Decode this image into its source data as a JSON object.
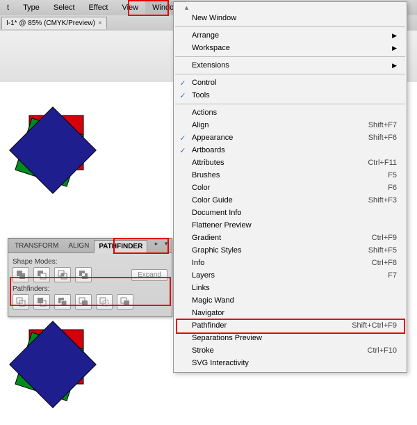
{
  "menubar": {
    "items": [
      "t",
      "Type",
      "Select",
      "Effect",
      "View",
      "Window"
    ],
    "highlighted_index": 5
  },
  "doc_tab": {
    "label": "I-1* @ 85% (CMYK/Preview)"
  },
  "window_menu": {
    "groups": [
      [
        {
          "label": "New Window"
        }
      ],
      [
        {
          "label": "Arrange",
          "submenu": true
        },
        {
          "label": "Workspace",
          "submenu": true
        }
      ],
      [
        {
          "label": "Extensions",
          "submenu": true
        }
      ],
      [
        {
          "label": "Control",
          "checked": true
        },
        {
          "label": "Tools",
          "checked": true
        }
      ],
      [
        {
          "label": "Actions"
        },
        {
          "label": "Align",
          "shortcut": "Shift+F7"
        },
        {
          "label": "Appearance",
          "checked": true,
          "shortcut": "Shift+F6"
        },
        {
          "label": "Artboards",
          "checked": true
        },
        {
          "label": "Attributes",
          "shortcut": "Ctrl+F11"
        },
        {
          "label": "Brushes",
          "shortcut": "F5"
        },
        {
          "label": "Color",
          "shortcut": "F6"
        },
        {
          "label": "Color Guide",
          "shortcut": "Shift+F3"
        },
        {
          "label": "Document Info"
        },
        {
          "label": "Flattener Preview"
        },
        {
          "label": "Gradient",
          "shortcut": "Ctrl+F9"
        },
        {
          "label": "Graphic Styles",
          "shortcut": "Shift+F5"
        },
        {
          "label": "Info",
          "shortcut": "Ctrl+F8"
        },
        {
          "label": "Layers",
          "shortcut": "F7"
        },
        {
          "label": "Links"
        },
        {
          "label": "Magic Wand"
        },
        {
          "label": "Navigator"
        },
        {
          "label": "Pathfinder",
          "shortcut": "Shift+Ctrl+F9",
          "highlight": true
        },
        {
          "label": "Separations Preview"
        },
        {
          "label": "Stroke",
          "shortcut": "Ctrl+F10"
        },
        {
          "label": "SVG Interactivity"
        }
      ]
    ]
  },
  "panel": {
    "tabs": [
      "TRANSFORM",
      "ALIGN",
      "PATHFINDER"
    ],
    "active_tab": 2,
    "shape_modes_label": "Shape Modes:",
    "pathfinders_label": "Pathfinders:",
    "expand_label": "Expand",
    "shape_mode_icons": [
      "unite-icon",
      "minus-front-icon",
      "intersect-icon",
      "exclude-icon"
    ],
    "pathfinder_icons": [
      "divide-icon",
      "trim-icon",
      "merge-icon",
      "crop-icon",
      "outline-icon",
      "minus-back-icon"
    ]
  },
  "colors": {
    "red_sq": "#d4000a",
    "green_sq": "#008a1f",
    "blue_sq": "#1e1e8f"
  }
}
